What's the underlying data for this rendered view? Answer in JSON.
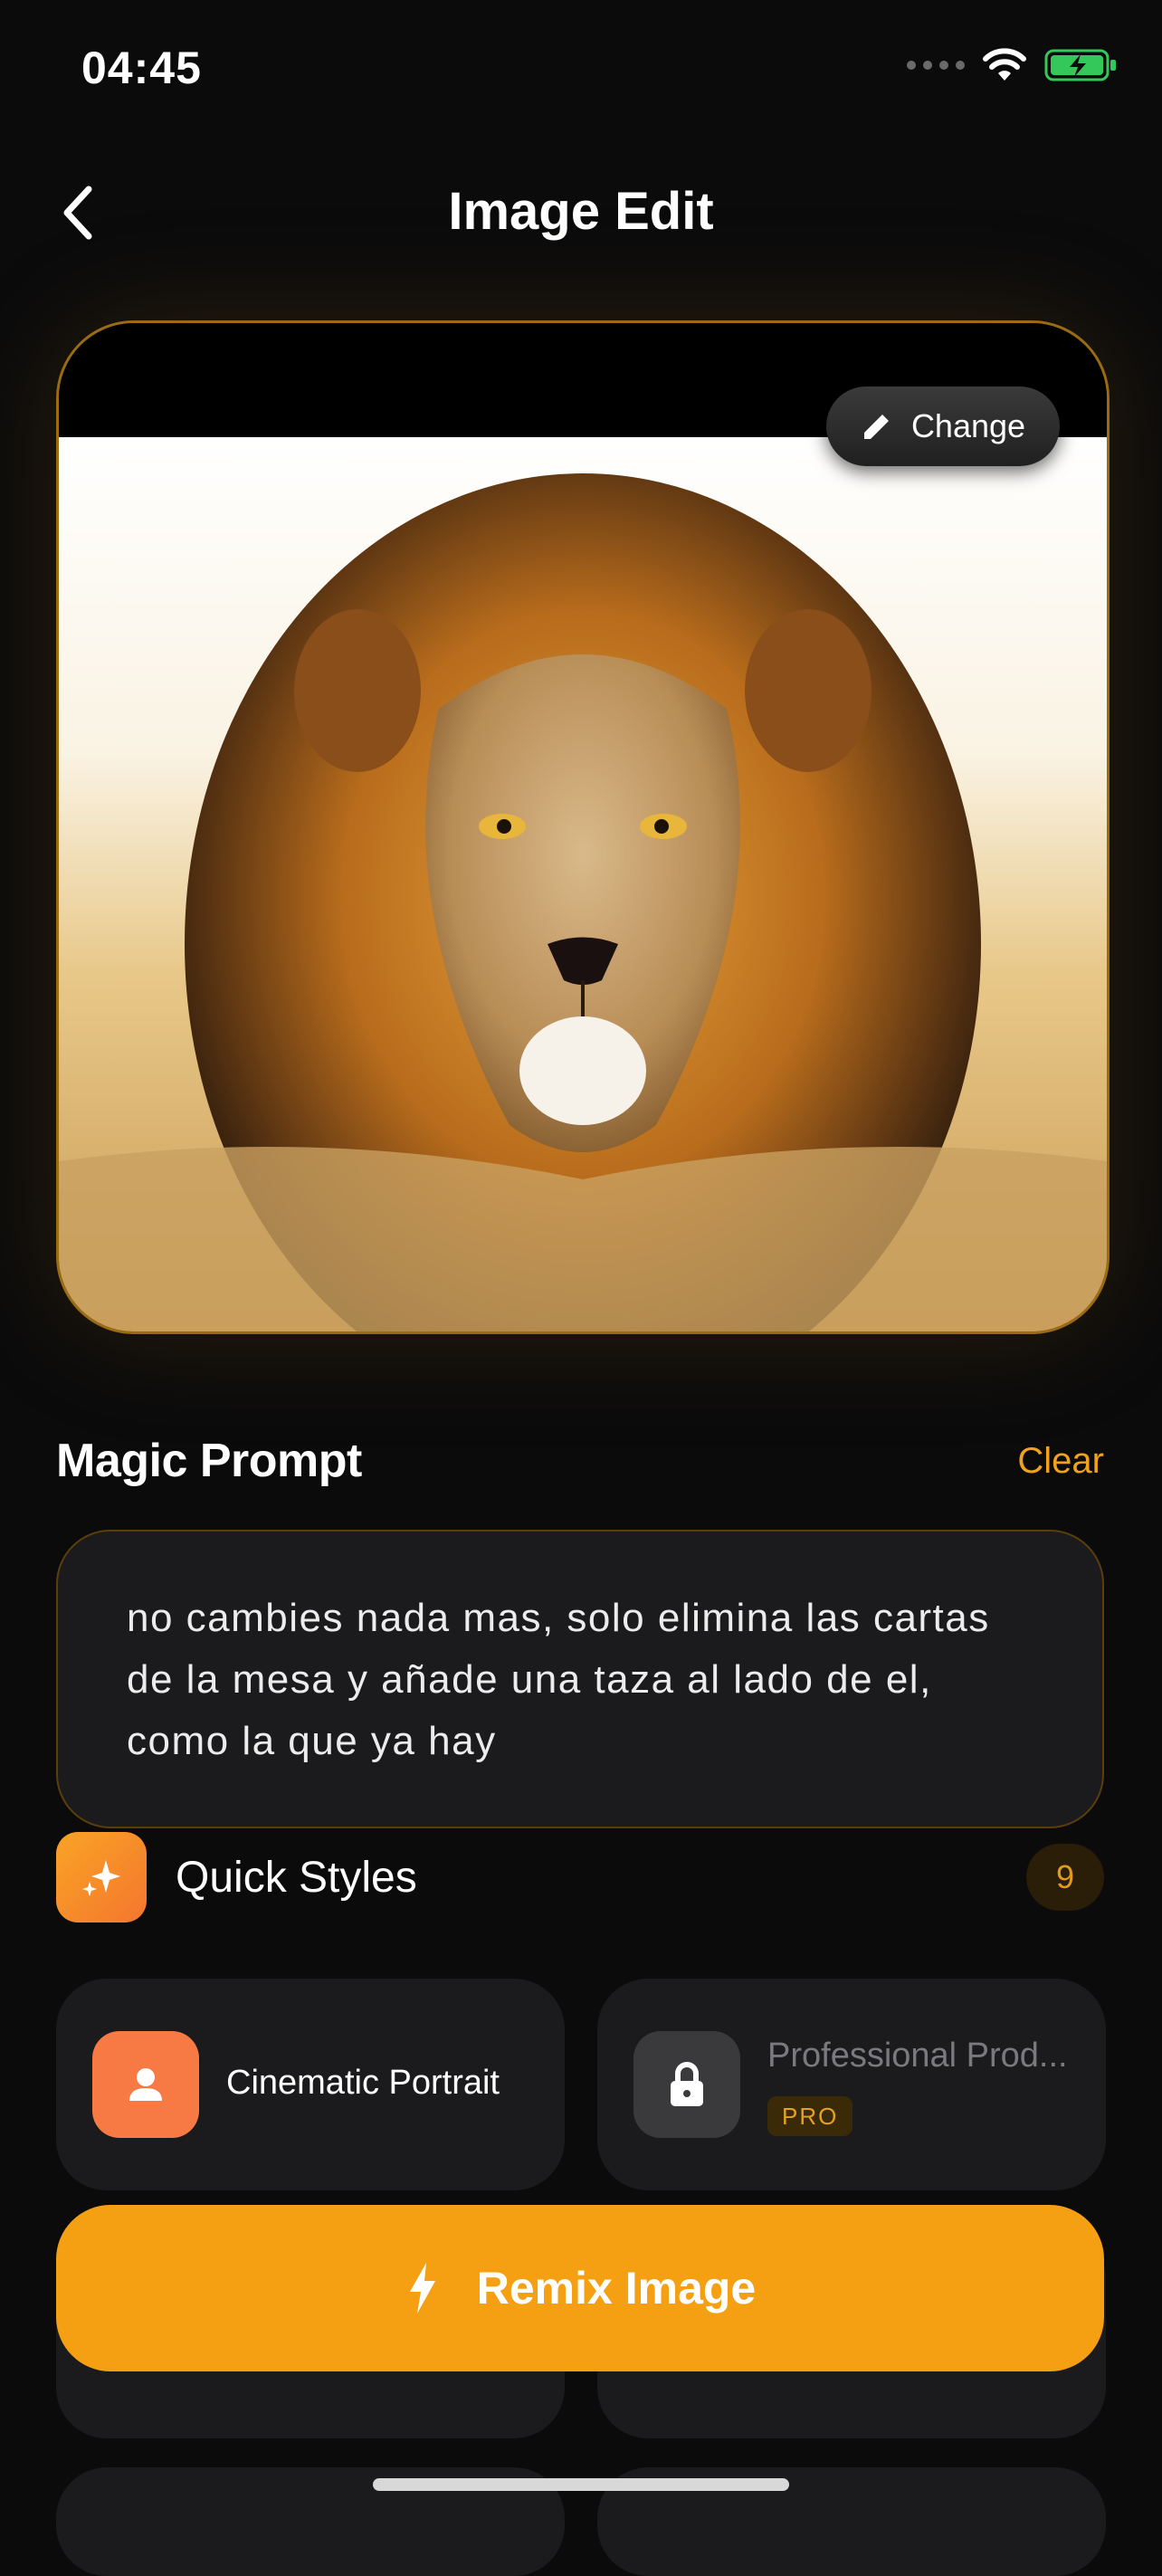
{
  "status_bar": {
    "time": "04:45"
  },
  "nav": {
    "title": "Image Edit"
  },
  "image": {
    "change_label": "Change"
  },
  "magic_prompt": {
    "title": "Magic Prompt",
    "clear_label": "Clear",
    "text": "no cambies nada mas, solo elimina las cartas de la mesa y añade una taza al lado de el, como la que ya hay"
  },
  "quick_styles": {
    "title": "Quick Styles",
    "count": "9",
    "items": [
      {
        "label": "Cinematic Portrait",
        "icon": "person-icon",
        "color": "#f77a45",
        "locked": false
      },
      {
        "label": "Professional Prod...",
        "icon": "lock-icon",
        "color": "#3a3a3c",
        "locked": true,
        "badge": "PRO"
      }
    ]
  },
  "remix_button": {
    "label": "Remix Image"
  },
  "colors": {
    "accent": "#f4a012",
    "background": "#0b0b0c",
    "card": "#1b1b1d"
  }
}
